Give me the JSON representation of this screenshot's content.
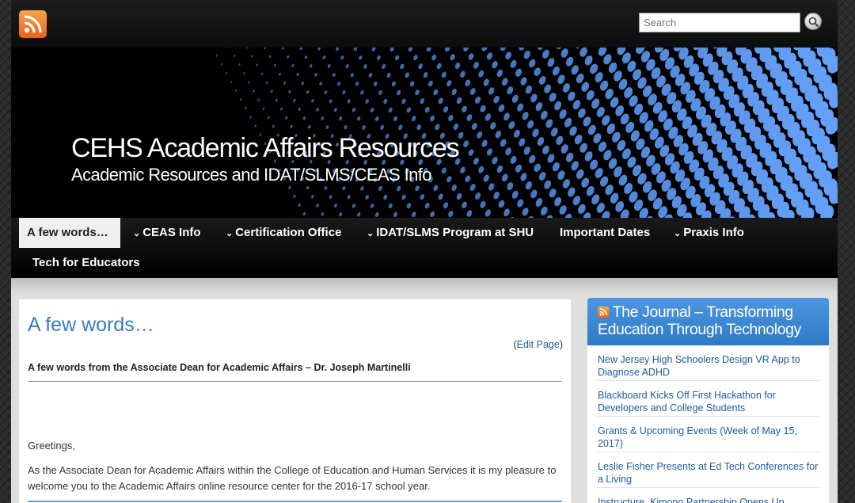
{
  "header": {
    "rss_icon": "rss-feed-icon",
    "search": {
      "placeholder": "Search",
      "button_icon": "search-icon"
    }
  },
  "banner": {
    "title": "CEHS Academic Affairs Resources",
    "description": "Academic Resources and IDAT/SLMS/CEAS Info"
  },
  "nav": {
    "items": [
      {
        "label": "A few words…",
        "active": true,
        "dropdown": false
      },
      {
        "label": "CEAS Info",
        "dropdown": true
      },
      {
        "label": "Certification Office",
        "dropdown": true
      },
      {
        "label": "IDAT/SLMS Program at SHU",
        "dropdown": true
      },
      {
        "label": "Important Dates",
        "dropdown": false
      },
      {
        "label": "Praxis Info",
        "dropdown": true
      },
      {
        "label": "Tech for Educators",
        "dropdown": false
      }
    ],
    "chevron": "⌄"
  },
  "post": {
    "title": "A few words…",
    "edit_open": "(",
    "edit_label": "Edit Page",
    "edit_close": ")",
    "subtitle": "A few words from the Associate Dean for Academic Affairs – Dr. Joseph Martinelli",
    "greeting": "Greetings,",
    "paragraph": "As the Associate Dean for Academic Affairs within the College of Education and Human Services it is my pleasure to welcome you to the Academic Affairs online resource center for the 2016-17 school year."
  },
  "sidebar": {
    "title": "The Journal – Transforming Education Through Technology",
    "items": [
      "New Jersey High Schoolers Design VR App to Diagnose ADHD",
      "Blackboard Kicks Off First Hackathon for Developers and College Students",
      "Grants & Upcoming Events (Week of May 15, 2017)",
      "Leslie Fisher Presents at Ed Tech Conferences for a Living",
      "Instructure, Kimono Partnership Opens Up"
    ]
  },
  "colors": {
    "accent_blue": "#3a7abf",
    "link_blue": "#1f5a9a",
    "sidebar_header": "#3b86d2",
    "rss_orange": "#e8641b"
  }
}
